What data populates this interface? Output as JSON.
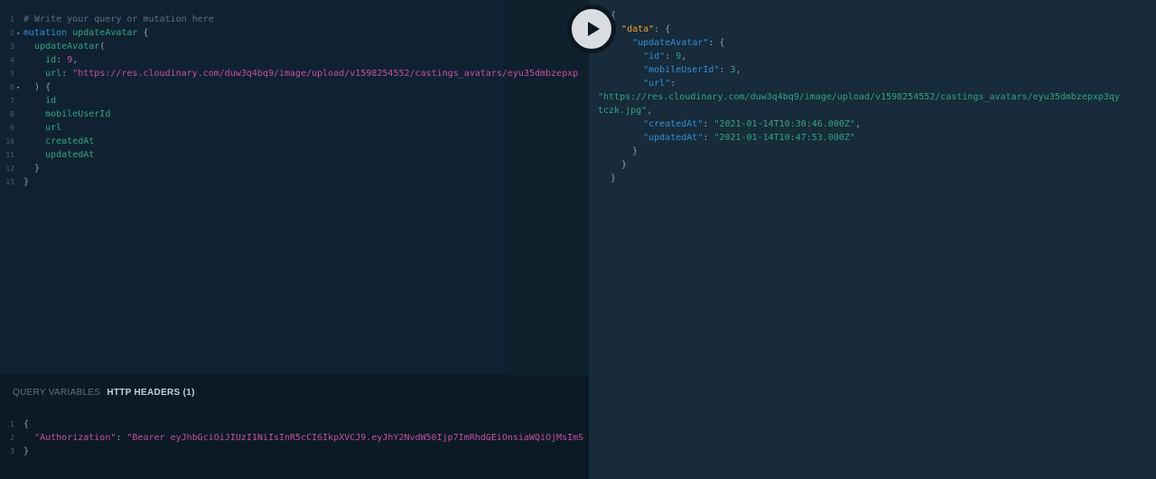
{
  "editor": {
    "lines": [
      {
        "n": "1",
        "comment": "# Write your query or mutation here"
      },
      {
        "n": "2",
        "kw": "mutation",
        "name": "updateAvatar",
        "open": "{"
      },
      {
        "n": "3",
        "fn": "updateAvatar",
        "paren": "("
      },
      {
        "n": "4",
        "arg": "id",
        "colon": ":",
        "value": "9",
        "comma": ","
      },
      {
        "n": "5",
        "arg": "url",
        "colon": ":",
        "value": "\"https://res.cloudinary.com/duw3q4bq9/image/upload/v1598254552/castings_avatars/eyu35dmbzepxp"
      },
      {
        "n": "6",
        "text": ") {"
      },
      {
        "n": "7",
        "field": "id"
      },
      {
        "n": "8",
        "field": "mobileUserId"
      },
      {
        "n": "9",
        "field": "url"
      },
      {
        "n": "10",
        "field": "createdAt"
      },
      {
        "n": "11",
        "field": "updatedAt"
      },
      {
        "n": "12",
        "text": "}"
      },
      {
        "n": "13",
        "text": "}"
      }
    ]
  },
  "bottom": {
    "tabs": [
      "QUERY VARIABLES",
      "HTTP HEADERS (1)"
    ],
    "header_lines": [
      {
        "n": "1",
        "text": "{"
      },
      {
        "n": "2",
        "key": "\"Authorization\"",
        "colon": ": ",
        "value": "\"Bearer eyJhbGciOiJIUzI1NiIsInR5cCI6IkpXVCJ9.eyJhY2NvdW50Ijp7ImRhdGEiOnsiaWQiOjMsImS"
      },
      {
        "n": "3",
        "text": "}"
      }
    ]
  },
  "result": {
    "open_brace": "{",
    "data_key": "\"data\"",
    "update_key": "\"updateAvatar\"",
    "id_key": "\"id\"",
    "id_val": "9",
    "mobile_key": "\"mobileUserId\"",
    "mobile_val": "3",
    "url_key": "\"url\"",
    "url_val_1": "\"https://res.cloudinary.com/duw3q4bq9/image/upload/v1598254552/castings_avatars/eyu35dmbzepxp3qy",
    "url_val_2": "tczk.jpg\"",
    "created_key": "\"createdAt\"",
    "created_val": "\"2021-01-14T10:30:46.000Z\"",
    "updated_key": "\"updatedAt\"",
    "updated_val": "\"2021-01-14T10:47:53.000Z\"",
    "close_brace": "}"
  }
}
